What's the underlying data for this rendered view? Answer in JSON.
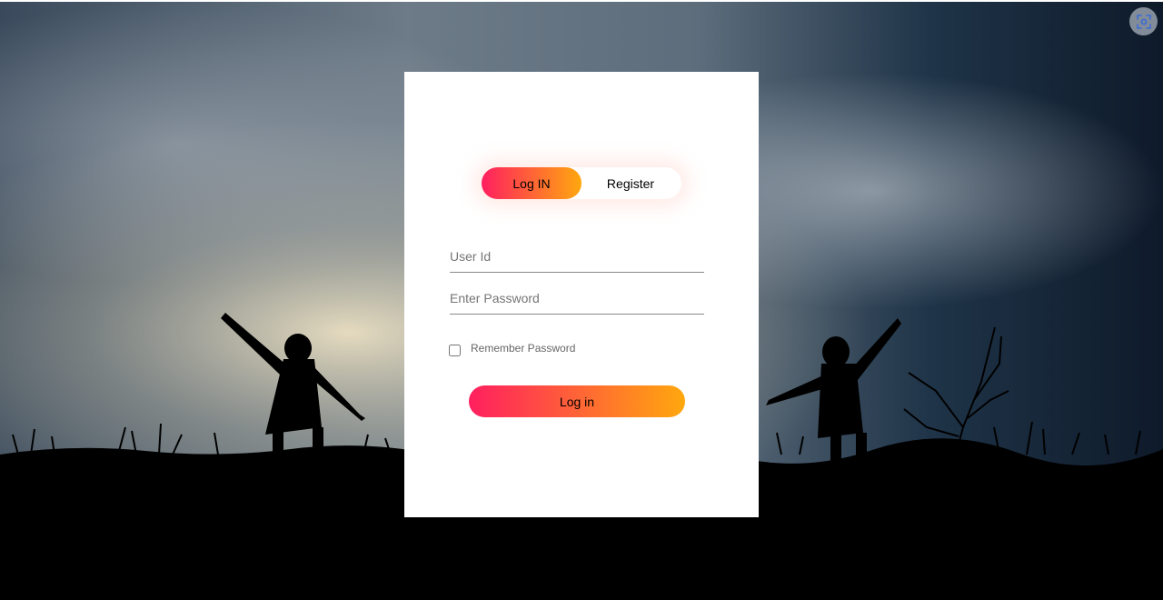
{
  "login_card": {
    "tabs": {
      "login_label": "Log IN",
      "register_label": "Register"
    },
    "user_id_placeholder": "User Id",
    "password_placeholder": "Enter Password",
    "remember_label": "Remember Password",
    "remember_checked": false,
    "submit_label": "Log in"
  },
  "icons": {
    "corner_button": "screenshot-capture-icon"
  },
  "colors": {
    "gradient_start": "#ff1f5f",
    "gradient_end": "#ffa80e",
    "card_background": "#ffffff"
  }
}
